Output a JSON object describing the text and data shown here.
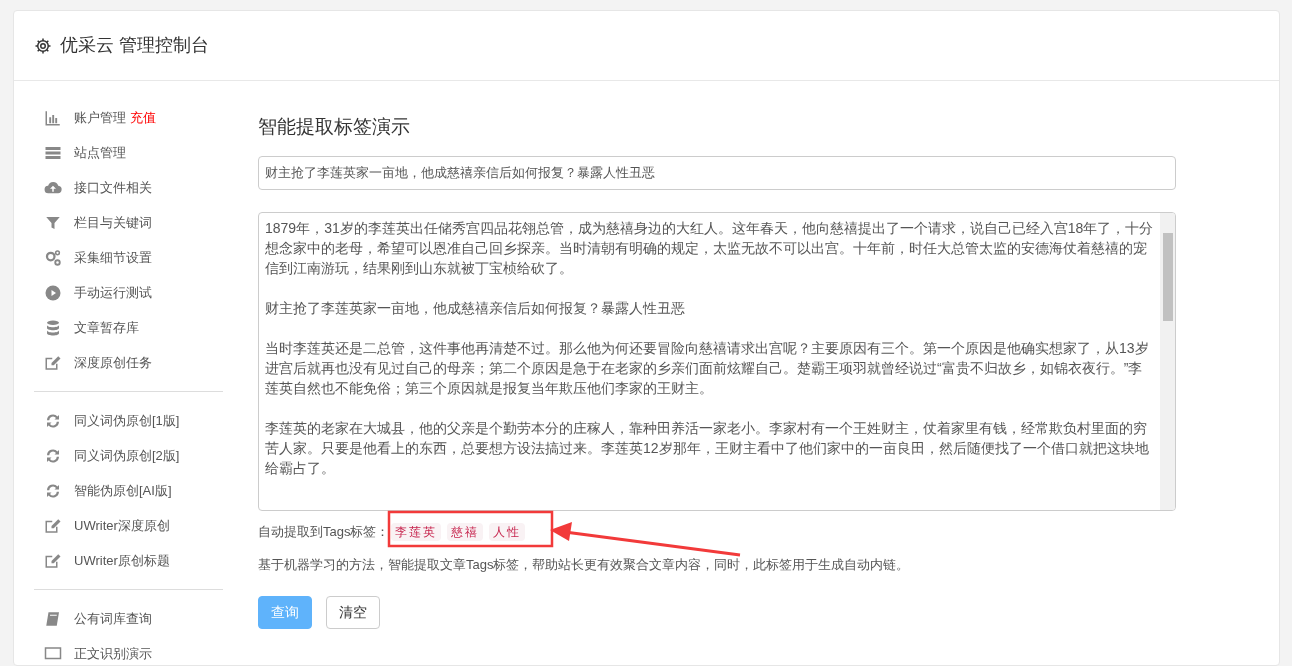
{
  "header": {
    "title": "优采云 管理控制台"
  },
  "sidebar": {
    "groups": [
      {
        "items": [
          {
            "kind": "chart",
            "label": "账户管理",
            "badge": "充值"
          },
          {
            "kind": "server",
            "label": "站点管理"
          },
          {
            "kind": "cloud",
            "label": "接口文件相关"
          },
          {
            "kind": "filter",
            "label": "栏目与关键词"
          },
          {
            "kind": "cogs",
            "label": "采集细节设置"
          },
          {
            "kind": "play",
            "label": "手动运行测试"
          },
          {
            "kind": "database",
            "label": "文章暂存库"
          },
          {
            "kind": "edit",
            "label": "深度原创任务"
          }
        ]
      },
      {
        "items": [
          {
            "kind": "refresh",
            "label": "同义词伪原创[1版]"
          },
          {
            "kind": "refresh",
            "label": "同义词伪原创[2版]"
          },
          {
            "kind": "refresh",
            "label": "智能伪原创[AI版]"
          },
          {
            "kind": "edit",
            "label": "UWriter深度原创"
          },
          {
            "kind": "edit",
            "label": "UWriter原创标题"
          }
        ]
      },
      {
        "items": [
          {
            "kind": "book",
            "label": "公有词库查询"
          },
          {
            "kind": "monitor",
            "label": "正文识别演示"
          }
        ]
      }
    ]
  },
  "main": {
    "heading": "智能提取标签演示",
    "title_field": {
      "value": "财主抢了李莲英家一亩地，他成慈禧亲信后如何报复？暴露人性丑恶"
    },
    "article_field": {
      "paragraphs": [
        "1879年，31岁的李莲英出任储秀宫四品花翎总管，成为慈禧身边的大红人。这年春天，他向慈禧提出了一个请求，说自己已经入宫18年了，十分想念家中的老母，希望可以恩准自己回乡探亲。当时清朝有明确的规定，太监无故不可以出宫。十年前，时任大总管太监的安德海仗着慈禧的宠信到江南游玩，结果刚到山东就被丁宝桢给砍了。",
        "财主抢了李莲英家一亩地，他成慈禧亲信后如何报复？暴露人性丑恶",
        "当时李莲英还是二总管，这件事他再清楚不过。那么他为何还要冒险向慈禧请求出宫呢？主要原因有三个。第一个原因是他确实想家了，从13岁进宫后就再也没有见过自己的母亲；第二个原因是急于在老家的乡亲们面前炫耀自己。楚霸王项羽就曾经说过“富贵不归故乡，如锦衣夜行。”李莲英自然也不能免俗；第三个原因就是报复当年欺压他们李家的王财主。",
        "李莲英的老家在大城县，他的父亲是个勤劳本分的庄稼人，靠种田养活一家老小。李家村有一个王姓财主，仗着家里有钱，经常欺负村里面的穷苦人家。只要是他看上的东西，总要想方设法搞过来。李莲英12岁那年，王财主看中了他们家中的一亩良田，然后随便找了一个借口就把这块地给霸占了。"
      ]
    },
    "tags_label": "自动提取到Tags标签：",
    "tags": [
      "李莲英",
      "慈禧",
      "人性"
    ],
    "description": "基于机器学习的方法，智能提取文章Tags标签，帮助站长更有效聚合文章内容，同时，此标签用于生成自动内链。",
    "buttons": [
      {
        "kind": "primary",
        "label": "查询"
      },
      {
        "kind": "default",
        "label": "清空"
      }
    ]
  }
}
